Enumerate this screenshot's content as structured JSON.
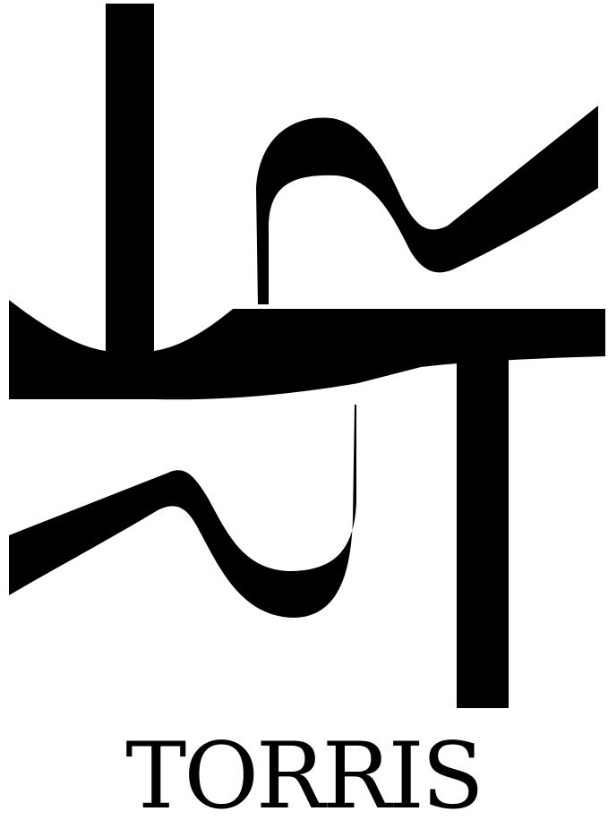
{
  "brand": {
    "name": "TORRIS",
    "logo_icon": "torris-calligraphic-monogram-icon"
  },
  "colors": {
    "ink": "#000000",
    "background": "#ffffff"
  }
}
